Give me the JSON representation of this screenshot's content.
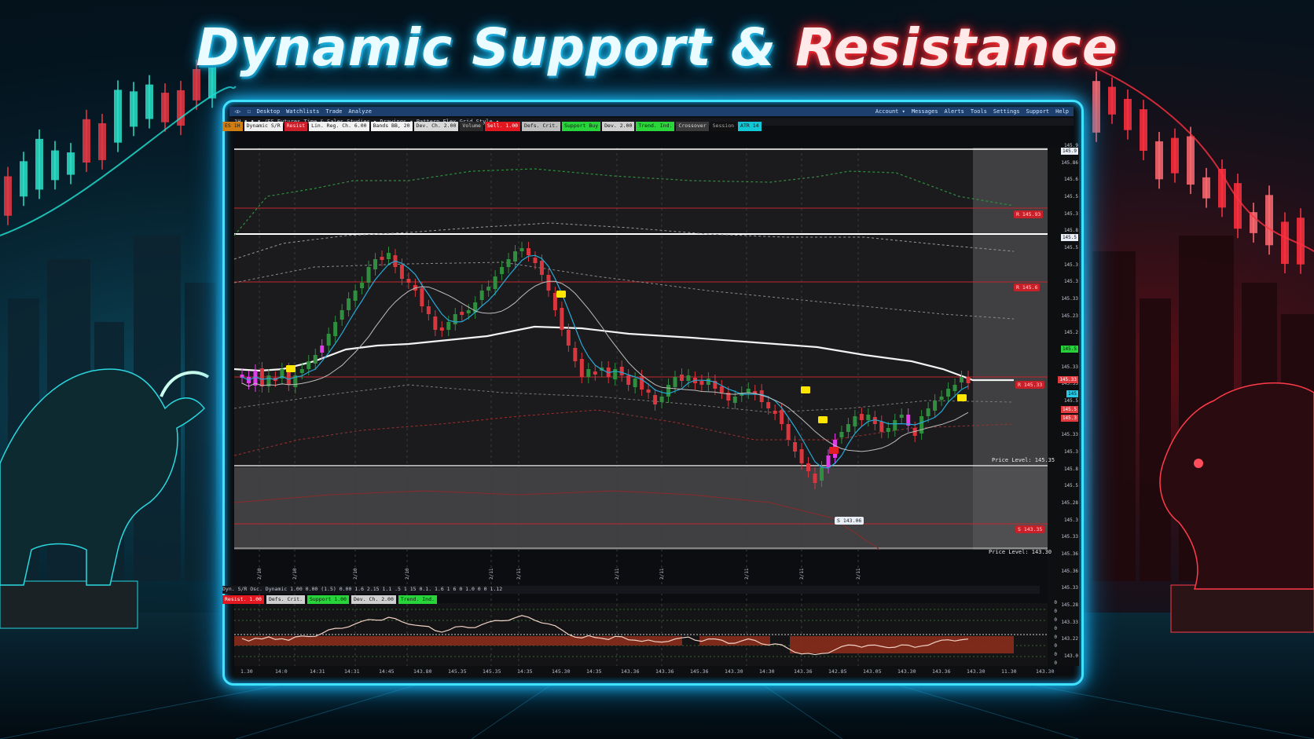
{
  "banner": {
    "title_part1": "Dynamic Support & ",
    "title_part2": "Resistance"
  },
  "colors": {
    "bull_accent": "#1fe0d0",
    "bear_accent": "#ff2b3a",
    "frame_glow": "#3fe3ff",
    "candle_up": "#2f8f3f",
    "candle_down": "#d9363e",
    "candle_highlight": "#e23be8",
    "ma_long": "#f2f2f2",
    "ma_short": "#27a9d6"
  },
  "window": {
    "toolbar_left": [
      "◁▷",
      "☐",
      "Desktop",
      "Watchlists",
      "Trade",
      "Analyze"
    ],
    "toolbar_right": [
      "Account ▾",
      "Messages",
      "Alerts",
      "Tools",
      "Settings",
      "Support",
      "Help"
    ],
    "subbar_text": "1H ▮ ▮ ▮ /ES  Futures   Time & Sales   Studies ▾   Drawings ▾   Pattern   Flex Grid   Style ▾"
  },
  "chips": [
    {
      "text": "ES 1H",
      "bg": "#d07d12",
      "fg": "#1a1a1a"
    },
    {
      "text": "Dynamic S/R",
      "bg": "#f0f0f0",
      "fg": "#111"
    },
    {
      "text": "Resist",
      "bg": "#cc1f2a",
      "fg": "#ffe4e4"
    },
    {
      "text": "Lin. Reg. Ch. 6.00",
      "bg": "#f2f2f2",
      "fg": "#111"
    },
    {
      "text": "Bands BB, 20",
      "bg": "#f2f2f2",
      "fg": "#111"
    },
    {
      "text": "Dev. Ch. 2.00",
      "bg": "#d8d8d8",
      "fg": "#111"
    },
    {
      "text": "Volume",
      "bg": "#2a2a2a",
      "fg": "#cfcfcf"
    },
    {
      "text": "Sell. 1.00",
      "bg": "#e3171f",
      "fg": "#fff"
    },
    {
      "text": "Defs. Crit.",
      "bg": "#bdbdbd",
      "fg": "#111"
    },
    {
      "text": "Support  Buy",
      "bg": "#27d43a",
      "fg": "#0b1c0c"
    },
    {
      "text": "Dev. 2.00",
      "bg": "#cfcfcf",
      "fg": "#111"
    },
    {
      "text": "Trend. Ind.",
      "bg": "#2bd63b",
      "fg": "#0b1c0c"
    },
    {
      "text": "Crossover",
      "bg": "#3a3a3a",
      "fg": "#ddd"
    },
    {
      "text": "Session",
      "bg": "#111",
      "fg": "#aaa"
    },
    {
      "text": "ATR 14",
      "bg": "#12c8d6",
      "fg": "#0a1a1c"
    }
  ],
  "chart_data": {
    "type": "line",
    "subtype": "candlestick",
    "y_axis_ticks": [
      "145.9",
      "145.86",
      "145.6",
      "145.5",
      "145.3",
      "145.8",
      "145.5",
      "145.3",
      "145.3",
      "145.33",
      "145.23",
      "145.2",
      "145",
      "145.33",
      "145.35",
      "145.5",
      "145.6",
      "145.33",
      "145.3",
      "145.8",
      "145.5",
      "145.28",
      "145.3",
      "145.33",
      "145.36",
      "145.36",
      "145.33",
      "145.28",
      "143.33",
      "143.22",
      "143.0"
    ],
    "x_axis_ticks": [
      "1.30",
      "14:0",
      "14:31",
      "14:31",
      "14:45",
      "143.80",
      "145.35",
      "145.35",
      "14:35",
      "145.30",
      "14:35",
      "143.36",
      "143.36",
      "145.36",
      "143.30",
      "14:30",
      "143.36",
      "142.85",
      "143.05",
      "143.30",
      "143.36",
      "143.30",
      "11.30",
      "143.30"
    ],
    "date_ticks": [
      "2/10",
      "2/10",
      "2/10",
      "2/10",
      "2/11",
      "2/11",
      "2/11",
      "2/11",
      "2/11",
      "2/11",
      "2/11"
    ],
    "price_tags": [
      "Price Level: 145.35",
      "Price Level: 143.30"
    ],
    "resistance_tags": [
      "R 145.93",
      "R 145.6",
      "R 145.33"
    ],
    "support_tag": "S 143.35",
    "current_tag": "S 143.06",
    "oscillator_header": "Dyn. S/R Osc. Dynamic 1.00 0.00 (1.5) 0.00 1.6 2.15 1.1 .5 1 15 0.1. 1.6 1 6 0 1.0 0 0 1.12",
    "oscillator_chips": [
      {
        "text": "Resist. 1.00",
        "bg": "#e3171f",
        "fg": "#fff"
      },
      {
        "text": "Defs. Crit.",
        "bg": "#cfcfcf",
        "fg": "#111"
      },
      {
        "text": "Support 1.00",
        "bg": "#27d43a",
        "fg": "#0b1c0c"
      },
      {
        "text": "Dev. Ch. 2.00",
        "bg": "#cfcfcf",
        "fg": "#111"
      },
      {
        "text": "Trend. Ind.",
        "bg": "#27d43a",
        "fg": "#0b1c0c"
      }
    ],
    "osc_y_ticks": [
      "0",
      "0",
      "0",
      "0",
      "0",
      "0",
      "0",
      "0"
    ]
  }
}
